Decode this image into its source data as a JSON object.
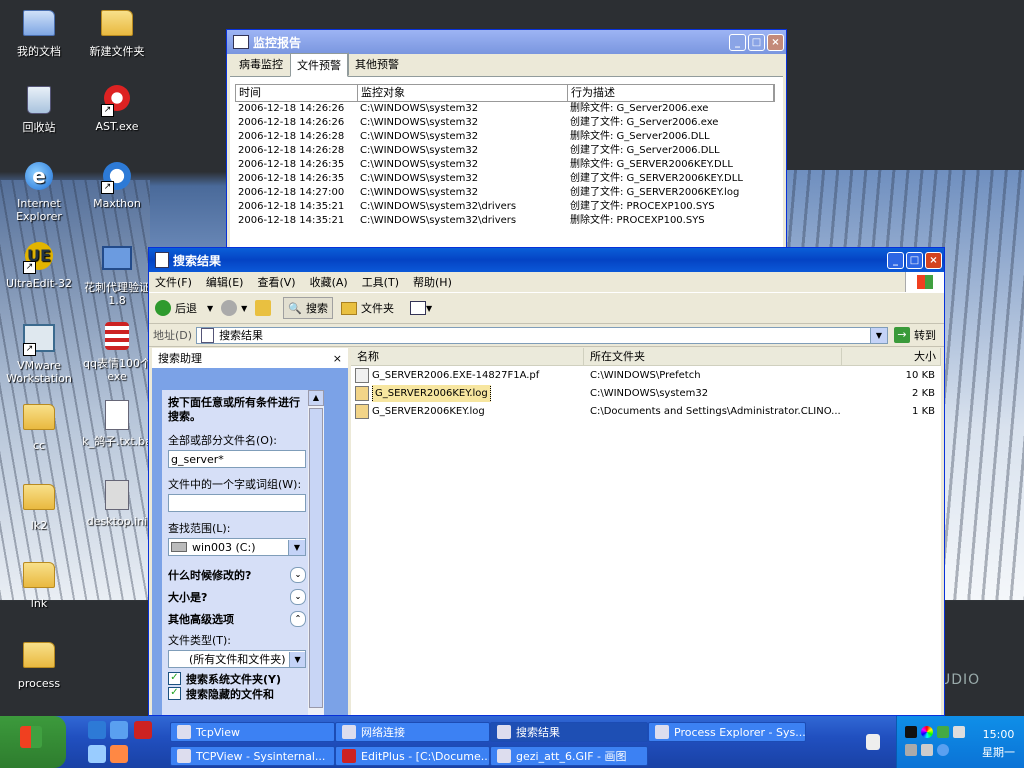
{
  "desktop": {
    "background_text": "UDIO",
    "icons": [
      {
        "name": "desktop-icon-my-documents",
        "label": "我的文档",
        "glyph": "documents-icon"
      },
      {
        "name": "desktop-icon-new-folder",
        "label": "新建文件夹",
        "glyph": "folder-icon"
      },
      {
        "name": "desktop-icon-recycle-bin",
        "label": "回收站",
        "glyph": "recycle-bin-icon"
      },
      {
        "name": "desktop-icon-ast",
        "label": "AST.exe",
        "glyph": "ast-app-icon"
      },
      {
        "name": "desktop-icon-ie",
        "label": "Internet Explorer",
        "glyph": "ie-icon"
      },
      {
        "name": "desktop-icon-maxthon",
        "label": "Maxthon",
        "glyph": "maxthon-icon"
      },
      {
        "name": "desktop-icon-ultraedit",
        "label": "UltraEdit-32",
        "glyph": "ultraedit-icon"
      },
      {
        "name": "desktop-icon-proxy",
        "label": "花刺代理验证 1.8",
        "glyph": "network-icon"
      },
      {
        "name": "desktop-icon-vmware",
        "label": "VMware Workstation",
        "glyph": "vmware-icon"
      },
      {
        "name": "desktop-icon-qq",
        "label": "qq表情100个 exe",
        "glyph": "qq-icon"
      },
      {
        "name": "desktop-icon-cc",
        "label": "cc",
        "glyph": "folder-icon"
      },
      {
        "name": "desktop-icon-gezi",
        "label": "k_鸽子.txt.ba",
        "glyph": "text-file-icon"
      },
      {
        "name": "desktop-icon-lk2",
        "label": "lk2",
        "glyph": "folder-icon"
      },
      {
        "name": "desktop-icon-desktop-ini",
        "label": "desktop.ini",
        "glyph": "settings-file-icon"
      },
      {
        "name": "desktop-icon-lnk",
        "label": "lnk",
        "glyph": "folder-icon"
      },
      {
        "name": "desktop-icon-process",
        "label": "process",
        "glyph": "folder-icon"
      }
    ]
  },
  "monitor_window": {
    "title": "监控报告",
    "tabs": [
      "病毒监控",
      "文件预警",
      "其他预警"
    ],
    "active_tab": 1,
    "columns": [
      "时间",
      "监控对象",
      "行为描述"
    ],
    "rows": [
      [
        "2006-12-18 14:26:26",
        "C:\\WINDOWS\\system32",
        "删除文件: G_Server2006.exe"
      ],
      [
        "2006-12-18 14:26:26",
        "C:\\WINDOWS\\system32",
        "创建了文件: G_Server2006.exe"
      ],
      [
        "2006-12-18 14:26:28",
        "C:\\WINDOWS\\system32",
        "删除文件: G_Server2006.DLL"
      ],
      [
        "2006-12-18 14:26:28",
        "C:\\WINDOWS\\system32",
        "创建了文件: G_Server2006.DLL"
      ],
      [
        "2006-12-18 14:26:35",
        "C:\\WINDOWS\\system32",
        "删除文件: G_SERVER2006KEY.DLL"
      ],
      [
        "2006-12-18 14:26:35",
        "C:\\WINDOWS\\system32",
        "创建了文件: G_SERVER2006KEY.DLL"
      ],
      [
        "2006-12-18 14:27:00",
        "C:\\WINDOWS\\system32",
        "创建了文件: G_SERVER2006KEY.log"
      ],
      [
        "2006-12-18 14:35:21",
        "C:\\WINDOWS\\system32\\drivers",
        "创建了文件: PROCEXP100.SYS"
      ],
      [
        "2006-12-18 14:35:21",
        "C:\\WINDOWS\\system32\\drivers",
        "删除文件: PROCEXP100.SYS"
      ]
    ]
  },
  "search_window": {
    "title": "搜索结果",
    "menu": [
      "文件(F)",
      "编辑(E)",
      "查看(V)",
      "收藏(A)",
      "工具(T)",
      "帮助(H)"
    ],
    "toolbar": {
      "back": "后退",
      "search": "搜索",
      "folders": "文件夹"
    },
    "address": {
      "label": "地址(D)",
      "value": "搜索结果",
      "go": "转到"
    },
    "assistant": {
      "header": "搜索助理",
      "close": "×",
      "intro": "按下面任意或所有条件进行搜索。",
      "name_label": "全部或部分文件名(O):",
      "name_value": "g_server*",
      "phrase_label": "文件中的一个字或词组(W):",
      "phrase_value": "",
      "look_in_label": "查找范围(L):",
      "look_in_value": "win003 (C:)",
      "when_modified": "什么时候修改的?",
      "size": "大小是?",
      "advanced": "其他高级选项",
      "type_label": "文件类型(T):",
      "type_value": "(所有文件和文件夹)",
      "search_system": "搜索系统文件夹(Y)",
      "search_hidden": "搜索隐藏的文件和"
    },
    "columns": [
      "名称",
      "所在文件夹",
      "大小"
    ],
    "results": [
      {
        "name": "G_SERVER2006.EXE-14827F1A.pf",
        "folder": "C:\\WINDOWS\\Prefetch",
        "size": "10 KB"
      },
      {
        "name": "G_SERVER2006KEY.log",
        "folder": "C:\\WINDOWS\\system32",
        "size": "2 KB"
      },
      {
        "name": "G_SERVER2006KEY.log",
        "folder": "C:\\Documents and Settings\\Administrator.CLINO...",
        "size": "1 KB"
      }
    ]
  },
  "taskbar": {
    "tasks_top": [
      "TcpView",
      "网络连接",
      "搜索结果",
      "Process Explorer - Sys..."
    ],
    "tasks_bottom": [
      "TCPView - Sysinternal...",
      "EditPlus - [C:\\Docume...",
      "gezi_att_6.GIF - 画图"
    ],
    "clock_time": "15:00",
    "clock_day": "星期一"
  },
  "colors": {
    "xp_blue": "#0a5fd8",
    "selection": "#f7e6a0",
    "pane_blue": "#7ba2e7"
  }
}
